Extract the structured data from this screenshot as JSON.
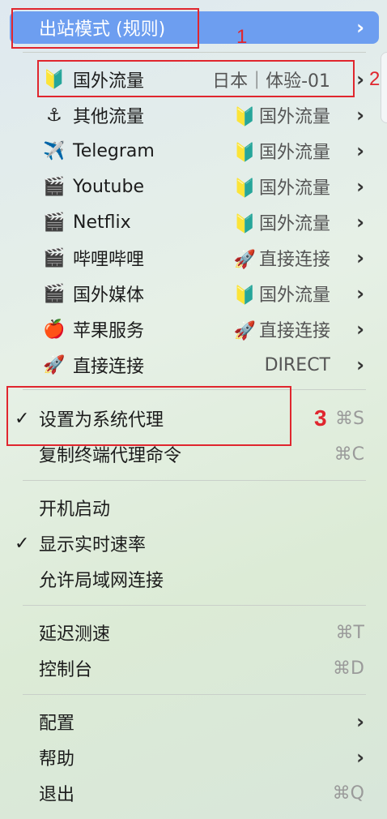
{
  "menu": {
    "outbound_mode_label": "出站模式 (规则)",
    "proxies": [
      {
        "icon": "🔰",
        "label": "国外流量",
        "value_icon": "",
        "value": "日本｜体验-01"
      },
      {
        "icon": "⚓",
        "label": "其他流量",
        "value_icon": "🔰",
        "value": "国外流量"
      },
      {
        "icon": "✈️",
        "label": "Telegram",
        "value_icon": "🔰",
        "value": "国外流量"
      },
      {
        "icon": "🎬",
        "label": "Youtube",
        "value_icon": "🔰",
        "value": "国外流量"
      },
      {
        "icon": "🎬",
        "label": "Netflix",
        "value_icon": "🔰",
        "value": "国外流量"
      },
      {
        "icon": "🎬",
        "label": "哔哩哔哩",
        "value_icon": "🚀",
        "value": "直接连接"
      },
      {
        "icon": "🎬",
        "label": "国外媒体",
        "value_icon": "🔰",
        "value": "国外流量"
      },
      {
        "icon": "🍎",
        "label": "苹果服务",
        "value_icon": "🚀",
        "value": "直接连接"
      },
      {
        "icon": "🚀",
        "label": "直接连接",
        "value_icon": "",
        "value": "DIRECT"
      }
    ],
    "system_proxy": {
      "label": "设置为系统代理",
      "check": "✓",
      "shortcut": "⌘S"
    },
    "copy_terminal": {
      "label": "复制终端代理命令",
      "shortcut": "⌘C"
    },
    "launch_at_login": {
      "label": "开机启动"
    },
    "show_speed": {
      "label": "显示实时速率",
      "check": "✓"
    },
    "allow_lan": {
      "label": "允许局域网连接"
    },
    "latency_test": {
      "label": "延迟测速",
      "shortcut": "⌘T"
    },
    "dashboard": {
      "label": "控制台",
      "shortcut": "⌘D"
    },
    "config": {
      "label": "配置"
    },
    "help": {
      "label": "帮助"
    },
    "quit": {
      "label": "退出",
      "shortcut": "⌘Q"
    }
  },
  "annotations": {
    "marker1": "1",
    "marker2": "2",
    "marker3": "3"
  },
  "colors": {
    "highlight": "#6d9ef0",
    "annotation_red": "#e0262e"
  }
}
